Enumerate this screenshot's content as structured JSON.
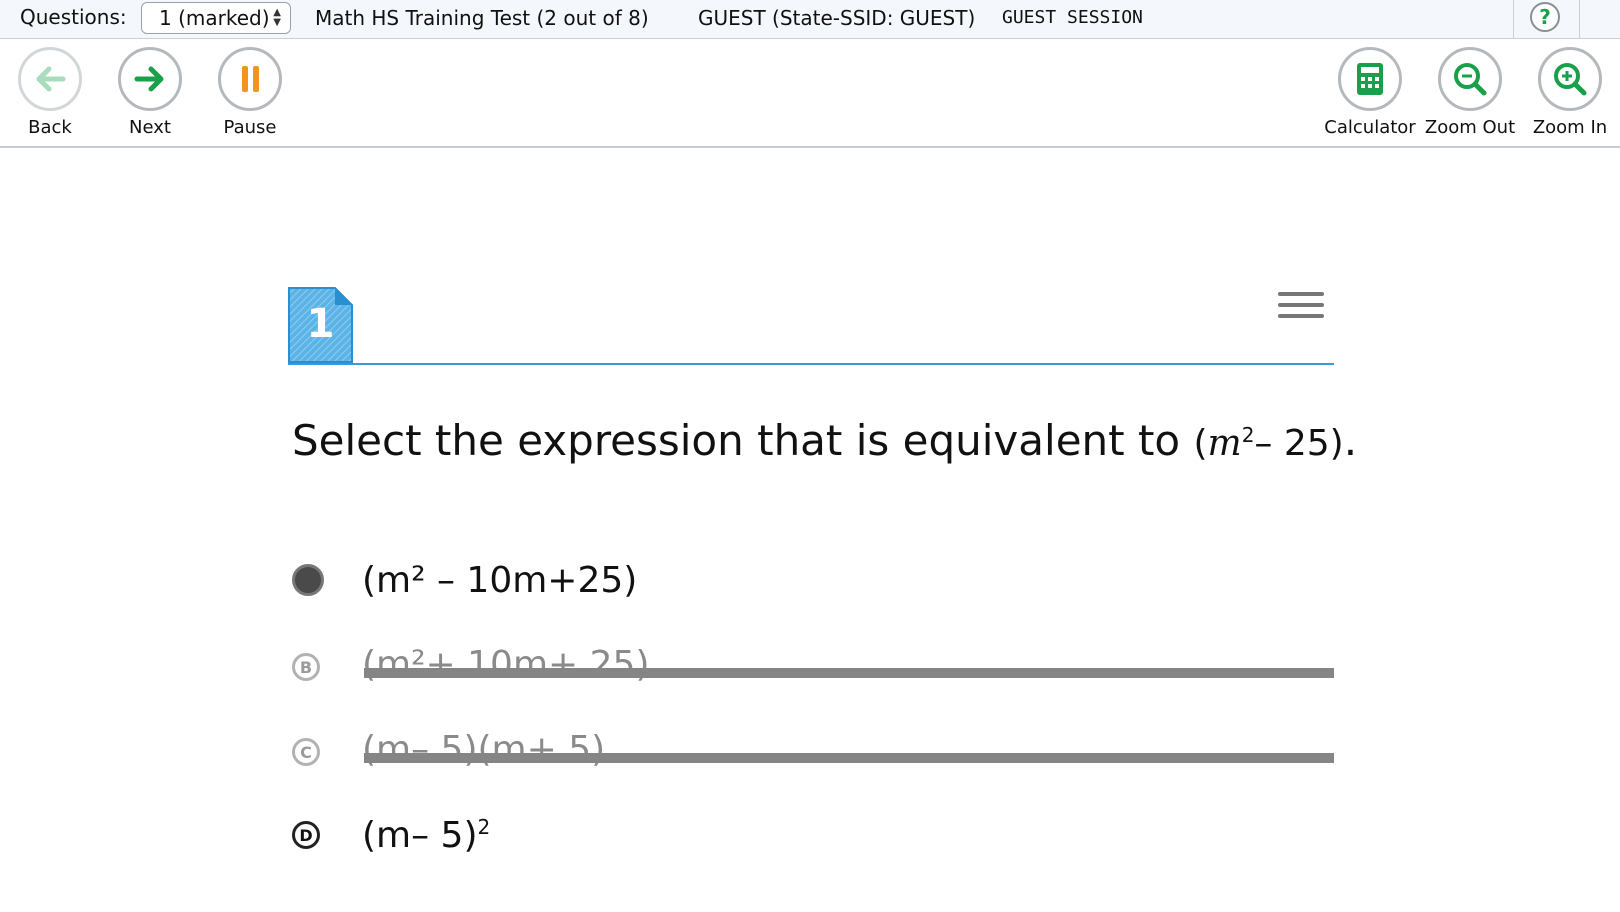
{
  "header": {
    "questions_label": "Questions:",
    "question_select_value": "1 (marked)",
    "test_title": "Math HS Training Test (2 out of 8)",
    "user": "GUEST (State-SSID: GUEST)",
    "session": "GUEST SESSION",
    "help_symbol": "?"
  },
  "toolbar": {
    "back_label": "Back",
    "next_label": "Next",
    "pause_label": "Pause",
    "calculator_label": "Calculator",
    "zoom_out_label": "Zoom Out",
    "zoom_in_label": "Zoom In"
  },
  "question": {
    "number": "1",
    "stem_text": "Select the expression that is equivalent to",
    "stem_expr_open": "(",
    "stem_expr_var": "m",
    "stem_expr_exp": "2",
    "stem_expr_rest": "– 25)",
    "stem_end": "."
  },
  "options": [
    {
      "letter": "A",
      "selected": true,
      "struck": false,
      "text": "(m² – 10m+25)"
    },
    {
      "letter": "B",
      "selected": false,
      "struck": true,
      "text": "(m²+ 10m+ 25)"
    },
    {
      "letter": "C",
      "selected": false,
      "struck": true,
      "text": "(m– 5)(m+ 5)"
    },
    {
      "letter": "D",
      "selected": false,
      "struck": false,
      "text": "(m– 5)",
      "exponent": "2"
    }
  ],
  "colors": {
    "accent_green": "#1aa04a",
    "pause_orange": "#f0961e",
    "question_blue": "#3a9ad9",
    "strike_gray": "#858585"
  },
  "icons": [
    "back-arrow-icon",
    "next-arrow-icon",
    "pause-icon",
    "calculator-icon",
    "zoom-out-icon",
    "zoom-in-icon",
    "help-icon",
    "menu-icon"
  ]
}
